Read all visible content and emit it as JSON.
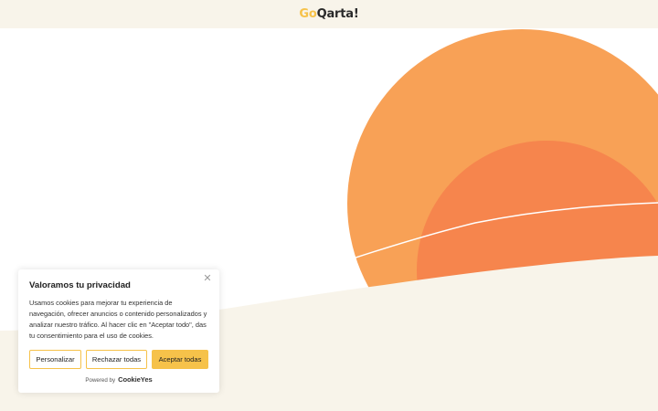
{
  "header": {
    "logo_part1": "Go",
    "logo_part2": "Qarta!"
  },
  "hero": {
    "colors": {
      "outer_circle": "#f8a156",
      "inner_circle": "#f6854d",
      "ground": "#f8f4ea",
      "line": "#ffffff"
    }
  },
  "cookie_banner": {
    "title": "Valoramos tu privacidad",
    "body": "Usamos cookies para mejorar tu experiencia de navegación, ofrecer anuncios o contenido personalizados y analizar nuestro tráfico. Al hacer clic en \"Aceptar todo\", das tu consentimiento para el uso de cookies.",
    "close_icon": "close-icon",
    "buttons": {
      "customize": "Personalizar",
      "reject": "Rechazar todas",
      "accept": "Aceptar todas"
    },
    "powered_by": "Powered by",
    "brand": "CookieYes",
    "accent": "#f6c24a"
  }
}
